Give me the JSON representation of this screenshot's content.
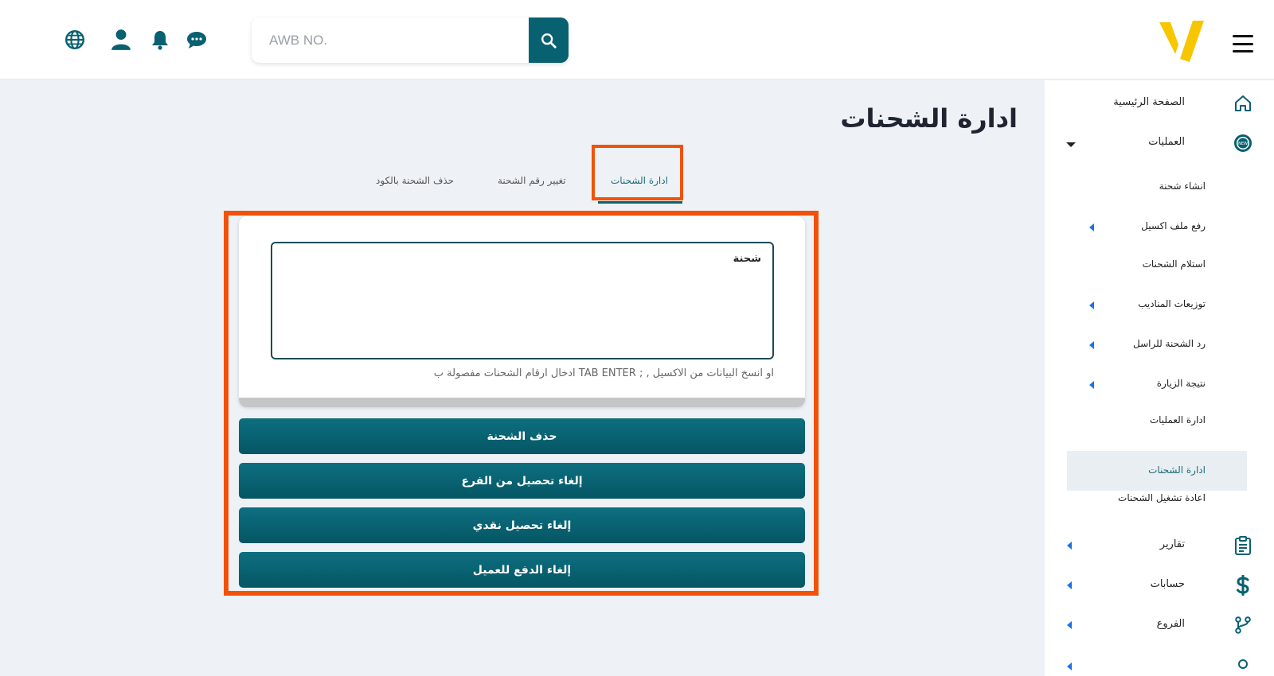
{
  "header": {
    "search_placeholder": "AWB NO.",
    "icons": [
      "globe-icon",
      "user-icon",
      "bell-icon",
      "chat-icon",
      "search-icon",
      "menu-icon"
    ]
  },
  "colors": {
    "primary": "#086170",
    "accent_yellow": "#f7c600",
    "highlight": "#f25207"
  },
  "sidebar": {
    "items": [
      {
        "label": "الصفحة الرئيسية"
      },
      {
        "label": "العمليات"
      },
      {
        "label": "انشاء شحنة"
      },
      {
        "label": "رفع ملف اكسيل"
      },
      {
        "label": "استلام الشحنات"
      },
      {
        "label": "توزيعات المناديب"
      },
      {
        "label": "رد الشحنة للراسل"
      },
      {
        "label": "نتيجة الزيارة"
      },
      {
        "label": "ادارة العمليات"
      },
      {
        "label": "ادارة الشحنات"
      },
      {
        "label": "اعادة تشغيل الشحنات"
      },
      {
        "label": "تقارير"
      },
      {
        "label": "حسابات"
      },
      {
        "label": "الفروع"
      }
    ],
    "badge_new": "NEW"
  },
  "main": {
    "title": "ادارة الشحنات",
    "tabs": [
      {
        "label": "ادارة الشحنات"
      },
      {
        "label": "تغيير رقم الشحنة"
      },
      {
        "label": "حذف الشحنة بالكود"
      }
    ],
    "textarea_label": "شحنة",
    "hint": "ادخال ارقام الشحنات مفصولة ب TAB ENTER ; , او انسخ البيانات من الاكسيل",
    "buttons": {
      "delete": "حذف الشحنة",
      "cancel_branch": "إلغاء تحصيل من الفرع",
      "cancel_cash": "إلغاء تحصيل نقدي",
      "cancel_payment": "إلغاء الدفع للعميل"
    }
  }
}
